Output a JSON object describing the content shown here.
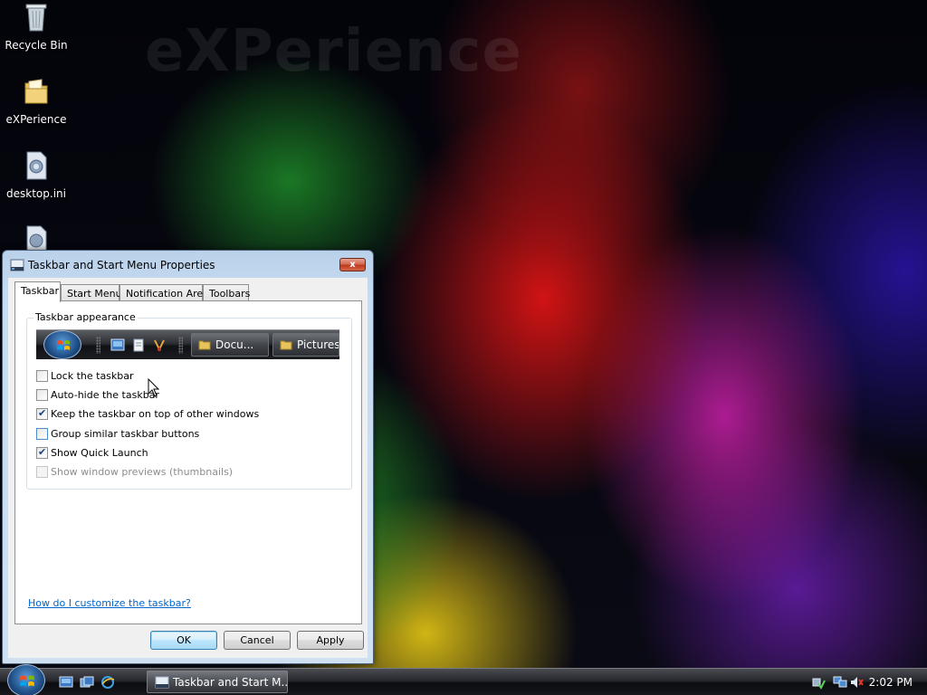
{
  "desktop": {
    "watermark": "eXPerience",
    "icons": [
      {
        "label": "Recycle Bin",
        "icon": "recycle-bin-icon"
      },
      {
        "label": "eXPerience",
        "icon": "folder-icon"
      },
      {
        "label": "desktop.ini",
        "icon": "settings-file-icon"
      }
    ]
  },
  "window": {
    "title": "Taskbar and Start Menu Properties",
    "close_label": "x",
    "tabs": [
      {
        "label": "Taskbar",
        "active": true
      },
      {
        "label": "Start Menu",
        "active": false
      },
      {
        "label": "Notification Area",
        "active": false
      },
      {
        "label": "Toolbars",
        "active": false
      }
    ],
    "group_label": "Taskbar appearance",
    "preview": {
      "buttons": [
        "Docu...",
        "Pictures"
      ]
    },
    "options": [
      {
        "label": "Lock the taskbar",
        "checked": false,
        "enabled": true
      },
      {
        "label": "Auto-hide the taskbar",
        "checked": false,
        "enabled": true
      },
      {
        "label": "Keep the taskbar on top of other windows",
        "checked": true,
        "enabled": true
      },
      {
        "label": "Group similar taskbar buttons",
        "checked": false,
        "enabled": true
      },
      {
        "label": "Show Quick Launch",
        "checked": true,
        "enabled": true
      },
      {
        "label": "Show window previews (thumbnails)",
        "checked": false,
        "enabled": false
      }
    ],
    "help_link": "How do I customize the taskbar?",
    "buttons": {
      "ok": "OK",
      "cancel": "Cancel",
      "apply": "Apply"
    }
  },
  "taskbar": {
    "task_label": "Taskbar and Start M...",
    "clock": "2:02 PM"
  },
  "colors": {
    "link": "#0066cc",
    "checkmark": "#1b3f7a"
  }
}
